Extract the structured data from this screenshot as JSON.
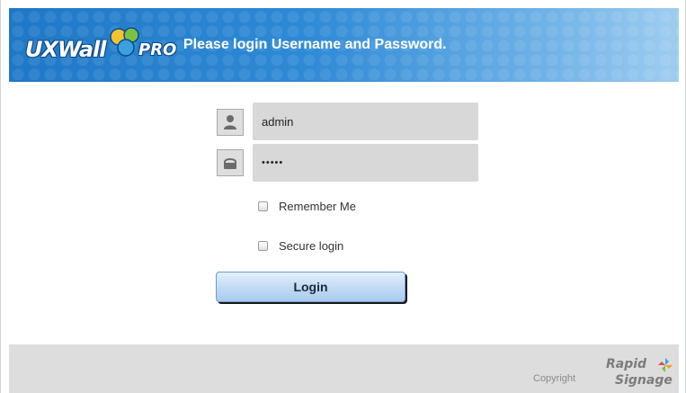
{
  "header": {
    "logo_text": "UXWall",
    "logo_suffix": "PRO",
    "title": "Please login Username and Password."
  },
  "form": {
    "username": {
      "value": "admin",
      "icon": "user-icon"
    },
    "password": {
      "value": "•••••",
      "icon": "lock-icon"
    },
    "remember_label": "Remember Me",
    "remember_checked": false,
    "secure_label": "Secure login",
    "secure_checked": false,
    "login_label": "Login"
  },
  "footer": {
    "copyright": "Copyright",
    "brand_line1": "Rapid",
    "brand_line2": "Signage"
  },
  "colors": {
    "header_blue": "#1f78c6",
    "field_gray": "#d8d8d8",
    "footer_gray": "#dddddd",
    "button_blue": "#c3dcf5"
  }
}
